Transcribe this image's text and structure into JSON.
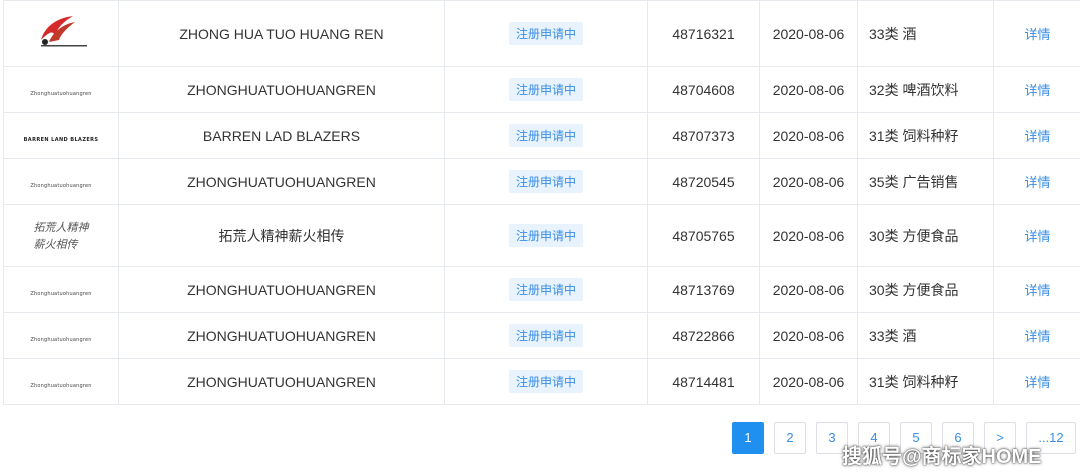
{
  "rows": [
    {
      "name": "ZHONG HUA TUO HUANG REN",
      "status": "注册申请中",
      "reg_no": "48716321",
      "date": "2020-08-06",
      "class": "33类 酒",
      "action": "详情"
    },
    {
      "logo_text": "Zhonghuatuohuangren",
      "name": "ZHONGHUATUOHUANGREN",
      "status": "注册申请中",
      "reg_no": "48704608",
      "date": "2020-08-06",
      "class": "32类 啤酒饮料",
      "action": "详情"
    },
    {
      "logo_text": "BARREN LAND BLAZERS",
      "name": "BARREN LAD BLAZERS",
      "status": "注册申请中",
      "reg_no": "48707373",
      "date": "2020-08-06",
      "class": "31类 饲料种籽",
      "action": "详情"
    },
    {
      "logo_text": "Zhonghuatuohuangren",
      "name": "ZHONGHUATUOHUANGREN",
      "status": "注册申请中",
      "reg_no": "48720545",
      "date": "2020-08-06",
      "class": "35类 广告销售",
      "action": "详情"
    },
    {
      "logo_line1": "拓荒人精神",
      "logo_line2": "薪火相传",
      "name": "拓荒人精神薪火相传",
      "status": "注册申请中",
      "reg_no": "48705765",
      "date": "2020-08-06",
      "class": "30类 方便食品",
      "action": "详情"
    },
    {
      "logo_text": "Zhonghuatuohuangren",
      "name": "ZHONGHUATUOHUANGREN",
      "status": "注册申请中",
      "reg_no": "48713769",
      "date": "2020-08-06",
      "class": "30类 方便食品",
      "action": "详情"
    },
    {
      "logo_text": "Zhonghuatuohuangren",
      "name": "ZHONGHUATUOHUANGREN",
      "status": "注册申请中",
      "reg_no": "48722866",
      "date": "2020-08-06",
      "class": "33类 酒",
      "action": "详情"
    },
    {
      "logo_text": "Zhonghuatuohuangren",
      "name": "ZHONGHUATUOHUANGREN",
      "status": "注册申请中",
      "reg_no": "48714481",
      "date": "2020-08-06",
      "class": "31类 饲料种籽",
      "action": "详情"
    }
  ],
  "pagination": {
    "pages": [
      "1",
      "2",
      "3",
      "4",
      "5",
      "6"
    ],
    "active": "1",
    "next": ">",
    "last": "...12"
  },
  "watermark": "搜狐号@商标家HOME",
  "colors": {
    "accent": "#1f8ff0",
    "status_bg": "#e8f3fd",
    "status_text": "#3a8ee6",
    "logo_red": "#d42a2a"
  }
}
